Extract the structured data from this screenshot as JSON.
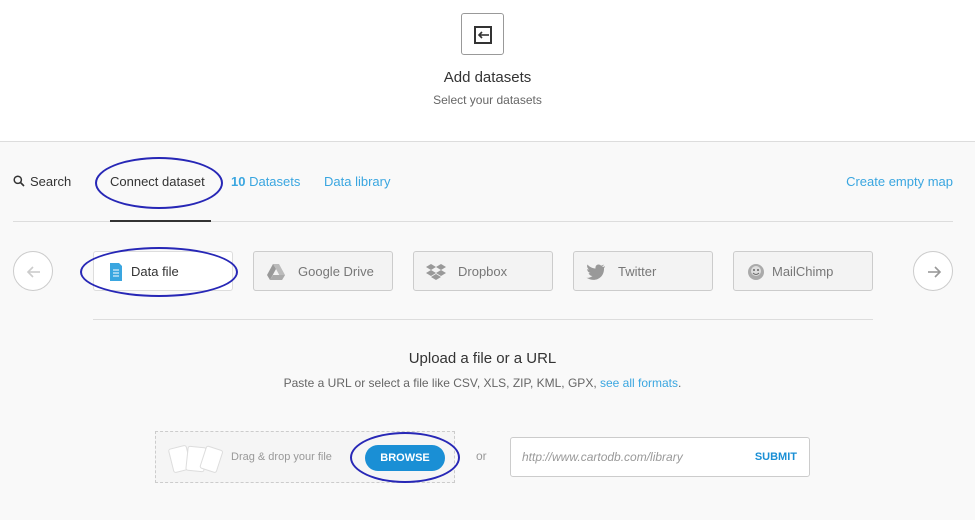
{
  "header": {
    "title": "Add datasets",
    "subtitle": "Select your datasets"
  },
  "nav": {
    "search_label": "Search",
    "connect_label": "Connect dataset",
    "datasets_count": "10",
    "datasets_label": " Datasets",
    "library_label": "Data library",
    "create_label": "Create empty map"
  },
  "sources": [
    {
      "label": "Data file",
      "icon": "data-file-icon",
      "active": true
    },
    {
      "label": "Google Drive",
      "icon": "google-drive-icon",
      "active": false
    },
    {
      "label": "Dropbox",
      "icon": "dropbox-icon",
      "active": false
    },
    {
      "label": "Twitter",
      "icon": "twitter-icon",
      "active": false
    },
    {
      "label": "MailChimp",
      "icon": "mailchimp-icon",
      "active": false
    }
  ],
  "upload": {
    "title": "Upload a file or a URL",
    "description": "Paste a URL or select a file like CSV, XLS, ZIP, KML, GPX, ",
    "formats_link": "see all formats",
    "period": ".",
    "drop_label": "Drag & drop your file",
    "browse_label": "BROWSE",
    "or_label": "or",
    "url_placeholder": "http://www.cartodb.com/library",
    "submit_label": "SUBMIT"
  },
  "colors": {
    "accent": "#3aa6e0",
    "button": "#1a8fd5",
    "annotation": "#2727b6"
  }
}
